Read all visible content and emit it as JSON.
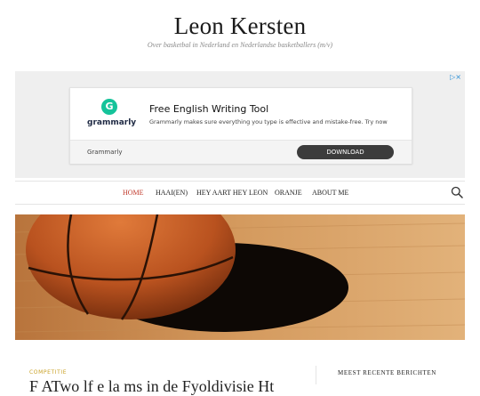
{
  "site": {
    "title": "Leon Kersten",
    "tagline": "Over basketbal in Nederland en Nederlandse basketballers (m/v)"
  },
  "ad": {
    "choices_label": "▷×",
    "brand_logo_text": "grammarly",
    "headline": "Free English Writing Tool",
    "description": "Grammarly makes sure everything you type is effective and mistake-free. Try now",
    "advertiser": "Grammarly",
    "cta_label": "DOWNLOAD",
    "colors": {
      "logo": "#15c39a",
      "cta": "#3c3c3c"
    }
  },
  "nav": {
    "items": [
      {
        "label": "HOME",
        "active": true
      },
      {
        "label": "HAAI(EN)",
        "active": false
      },
      {
        "label": "HEY AART HEY LEON",
        "active": false
      },
      {
        "label": "ORANJE",
        "active": false
      },
      {
        "label": "ABOUT ME",
        "active": false
      }
    ],
    "search_icon": "search-icon",
    "active_color": "#c0392b"
  },
  "hero": {
    "alt_icon": "basketball-on-court-image"
  },
  "post": {
    "category": "COMPETITIE",
    "title_visible": "F ATwo lf e la ms in de Fyoldivisie Ht"
  },
  "sidebar": {
    "heading": "MEEST RECENTE BERICHTEN"
  }
}
